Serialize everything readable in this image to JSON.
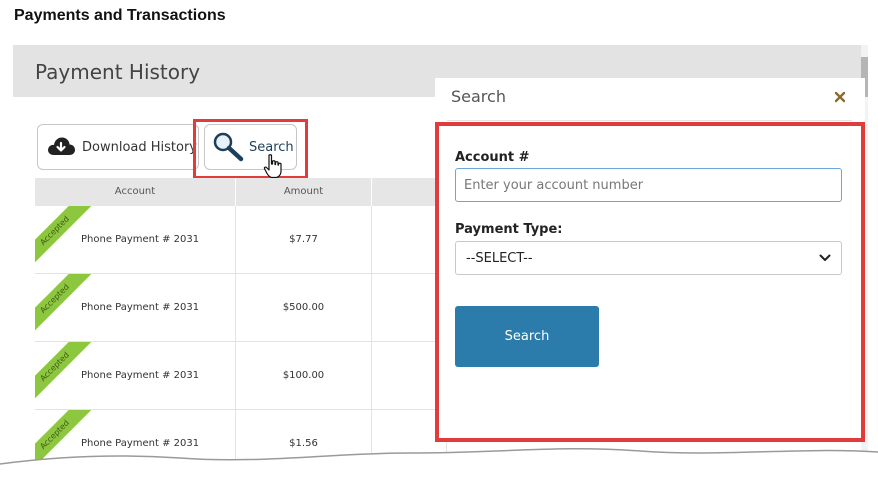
{
  "doc_title": "Payments and Transactions",
  "section_header": "Payment History",
  "toolbar": {
    "download_label": "Download History",
    "search_label": "Search"
  },
  "table": {
    "columns": [
      "Account",
      "Amount"
    ],
    "rows": [
      {
        "status": "Accepted",
        "account": "Phone Payment # 2031",
        "amount": "$7.77"
      },
      {
        "status": "Accepted",
        "account": "Phone Payment # 2031",
        "amount": "$500.00"
      },
      {
        "status": "Accepted",
        "account": "Phone Payment # 2031",
        "amount": "$100.00"
      },
      {
        "status": "Accepted",
        "account": "Phone Payment # 2031",
        "amount": "$1.56"
      }
    ]
  },
  "search_panel": {
    "title": "Search",
    "account_label": "Account #",
    "account_placeholder": "Enter your account number",
    "account_value": "",
    "type_label": "Payment Type:",
    "type_selected": "--SELECT--",
    "submit_label": "Search"
  },
  "colors": {
    "highlight": "#e23b3b",
    "submit": "#2b7bab",
    "ribbon": "#8dc63f",
    "close_icon": "#8a6d2c"
  },
  "icons": {
    "download": "cloud-download-icon",
    "search": "magnifier-icon",
    "close": "close-icon",
    "cursor": "hand-pointer-icon",
    "dropdown": "chevron-down-icon"
  }
}
